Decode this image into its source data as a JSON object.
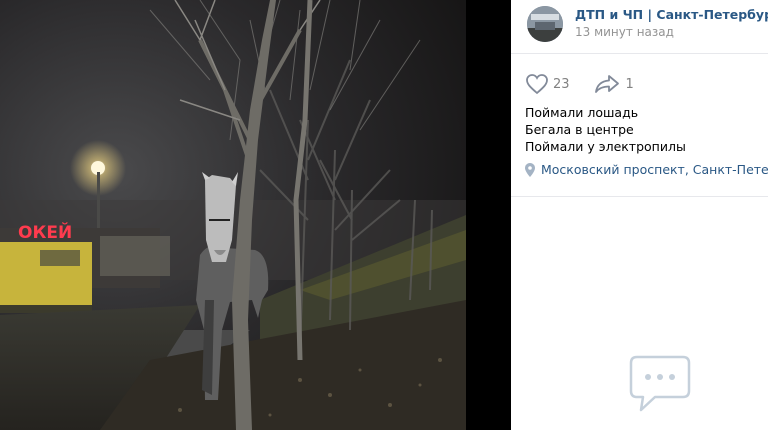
{
  "photo": {
    "store_sign": "ОКЕЙ"
  },
  "post": {
    "group_name": "ДТП и ЧП | Санкт-Петербург | Пит",
    "time": "13 минут назад",
    "likes": "23",
    "shares": "1",
    "text_lines": [
      "Поймали лошадь",
      "Бегала в центре",
      "Поймали у электропилы"
    ],
    "location": "Московский проспект, Санкт-Петербург"
  },
  "icons": {
    "like": "heart-icon",
    "share": "share-arrow-icon",
    "location": "location-pin-icon",
    "comments": "comment-bubble-icon"
  },
  "colors": {
    "link": "#2a5885",
    "muted": "#939393",
    "icon": "#828a99",
    "comment_icon": "#c5d0db"
  }
}
